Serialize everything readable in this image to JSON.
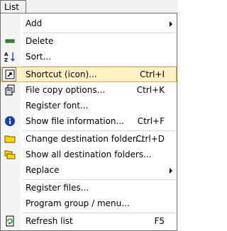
{
  "menubar": {
    "title": "List"
  },
  "menu": {
    "items": [
      {
        "label": "Add",
        "submenu": true
      },
      {
        "label": "Delete",
        "shortcut": ""
      },
      {
        "label": "Sort...",
        "shortcut": ""
      },
      {
        "label": "Shortcut (icon)...",
        "shortcut": "Ctrl+I",
        "selected": true
      },
      {
        "label": "File copy options...",
        "shortcut": "Ctrl+K"
      },
      {
        "label": "Register font...",
        "shortcut": ""
      },
      {
        "label": "Show file information...",
        "shortcut": "Ctrl+F"
      },
      {
        "label": "Change destination folder...",
        "shortcut": "Ctrl+D"
      },
      {
        "label": "Show all destination folders...",
        "shortcut": ""
      },
      {
        "label": "Replace",
        "submenu": true
      },
      {
        "label": "Register files...",
        "shortcut": ""
      },
      {
        "label": "Program group / menu...",
        "shortcut": ""
      },
      {
        "label": "Refresh list",
        "shortcut": "F5"
      }
    ],
    "icons": {
      "delete": "minus-icon",
      "sort": "sort-az-icon",
      "shortcut": "shortcut-icon",
      "filecopy": "file-copy-icon",
      "info": "info-icon",
      "change_folder": "folder-icon",
      "all_folders": "folders-icon",
      "refresh": "refresh-icon"
    }
  },
  "colors": {
    "selected_bg": "#fff1c4",
    "selected_border": "#e4b256",
    "gutter": "#f4f4f4",
    "separator": "#d6d6d6"
  }
}
